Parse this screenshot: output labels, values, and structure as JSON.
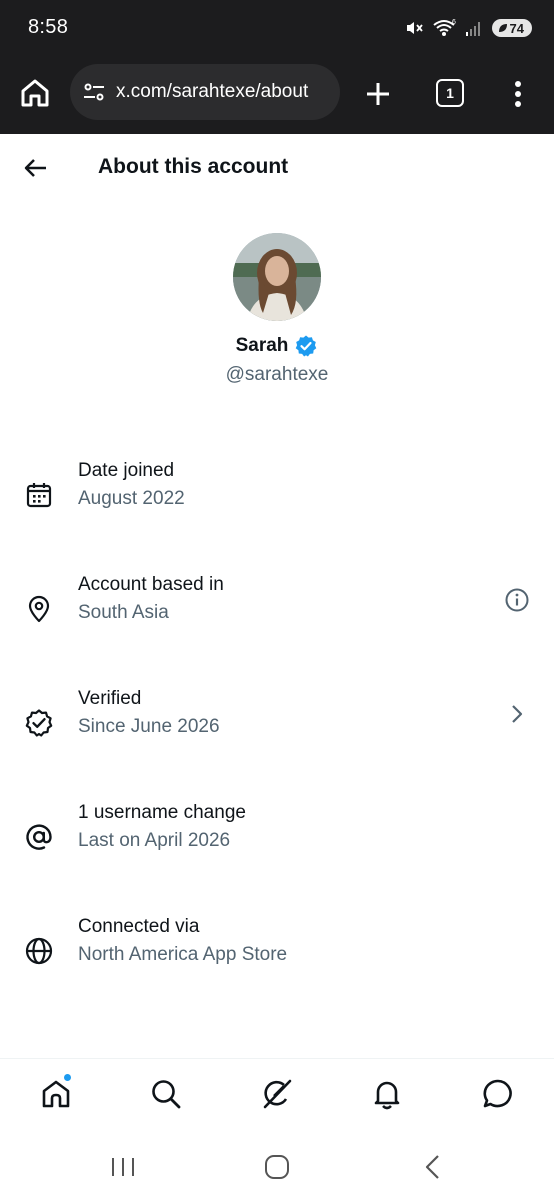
{
  "status_bar": {
    "time": "8:58",
    "battery": "74",
    "network_label": "6"
  },
  "browser": {
    "url": "x.com/sarahtexe/about",
    "tab_count": "1"
  },
  "header": {
    "title": "About this account"
  },
  "profile": {
    "name": "Sarah",
    "handle": "@sarahtexe",
    "verified_color": "#1d9bf0"
  },
  "info_items": [
    {
      "icon": "calendar-icon",
      "label": "Date joined",
      "value": "August 2022"
    },
    {
      "icon": "location-pin-icon",
      "label": "Account based in",
      "value": "South Asia",
      "trailing": "info-icon"
    },
    {
      "icon": "verified-badge-outline-icon",
      "label": "Verified",
      "value": "Since June 2026",
      "trailing": "chevron-right-icon"
    },
    {
      "icon": "at-sign-icon",
      "label": "1 username change",
      "value": "Last on April 2026"
    },
    {
      "icon": "globe-icon",
      "label": "Connected via",
      "value": "North America App Store"
    }
  ],
  "bottom_nav": [
    "home-icon",
    "search-icon",
    "grok-icon",
    "bell-icon",
    "messages-icon"
  ],
  "colors": {
    "accent": "#1d9bf0",
    "secondary_text": "#536471",
    "chrome_bg": "#1c1c1e"
  }
}
